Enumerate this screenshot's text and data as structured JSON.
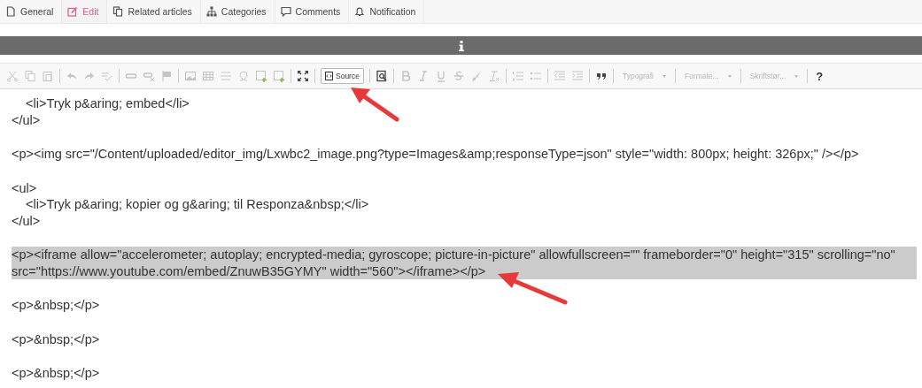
{
  "tabs": [
    {
      "label": "General",
      "selected": false
    },
    {
      "label": "Edit",
      "selected": true
    },
    {
      "label": "Related articles",
      "selected": false
    },
    {
      "label": "Categories",
      "selected": false
    },
    {
      "label": "Comments",
      "selected": false
    },
    {
      "label": "Notification",
      "selected": false
    }
  ],
  "toolbar": {
    "source_button": {
      "label": "Source",
      "selected": true
    },
    "dropdowns": [
      {
        "label": "Typografi"
      },
      {
        "label": "Formate..."
      },
      {
        "label": "Skriftstør..."
      }
    ],
    "help": "?"
  },
  "blocks": [
    [
      {
        "kind": "indented",
        "text": "<li>Tryk p&aring; embed</li>",
        "selected": false
      },
      {
        "kind": "plain",
        "text": "</ul>",
        "selected": false
      }
    ],
    [
      {
        "kind": "plain",
        "text": "<p><img src=\"/Content/uploaded/editor_img/Lxwbc2_image.png?type=Images&amp;responseType=json\" style=\"width: 800px; height: 326px;\" /></p>",
        "selected": false
      }
    ],
    [
      {
        "kind": "plain",
        "text": "<ul>",
        "selected": false
      },
      {
        "kind": "indented",
        "text": "<li>Tryk p&aring; kopier og g&aring; til Responza&nbsp;</li>",
        "selected": false
      },
      {
        "kind": "plain",
        "text": "</ul>",
        "selected": false
      }
    ],
    [
      {
        "kind": "plain",
        "text": "<p><iframe allow=\"accelerometer; autoplay; encrypted-media; gyroscope; picture-in-picture\" allowfullscreen=\"\" frameborder=\"0\" height=\"315\" scrolling=\"no\" src=\"https://www.youtube.com/embed/ZnuwB35GYMY\" width=\"560\"></iframe></p>",
        "selected": true
      }
    ],
    [
      {
        "kind": "plain",
        "text": "<p>&nbsp;</p>",
        "selected": false
      }
    ],
    [
      {
        "kind": "plain",
        "text": "<p>&nbsp;</p>",
        "selected": false
      }
    ],
    [
      {
        "kind": "plain",
        "text": "<p>&nbsp;</p>",
        "selected": false
      }
    ]
  ]
}
